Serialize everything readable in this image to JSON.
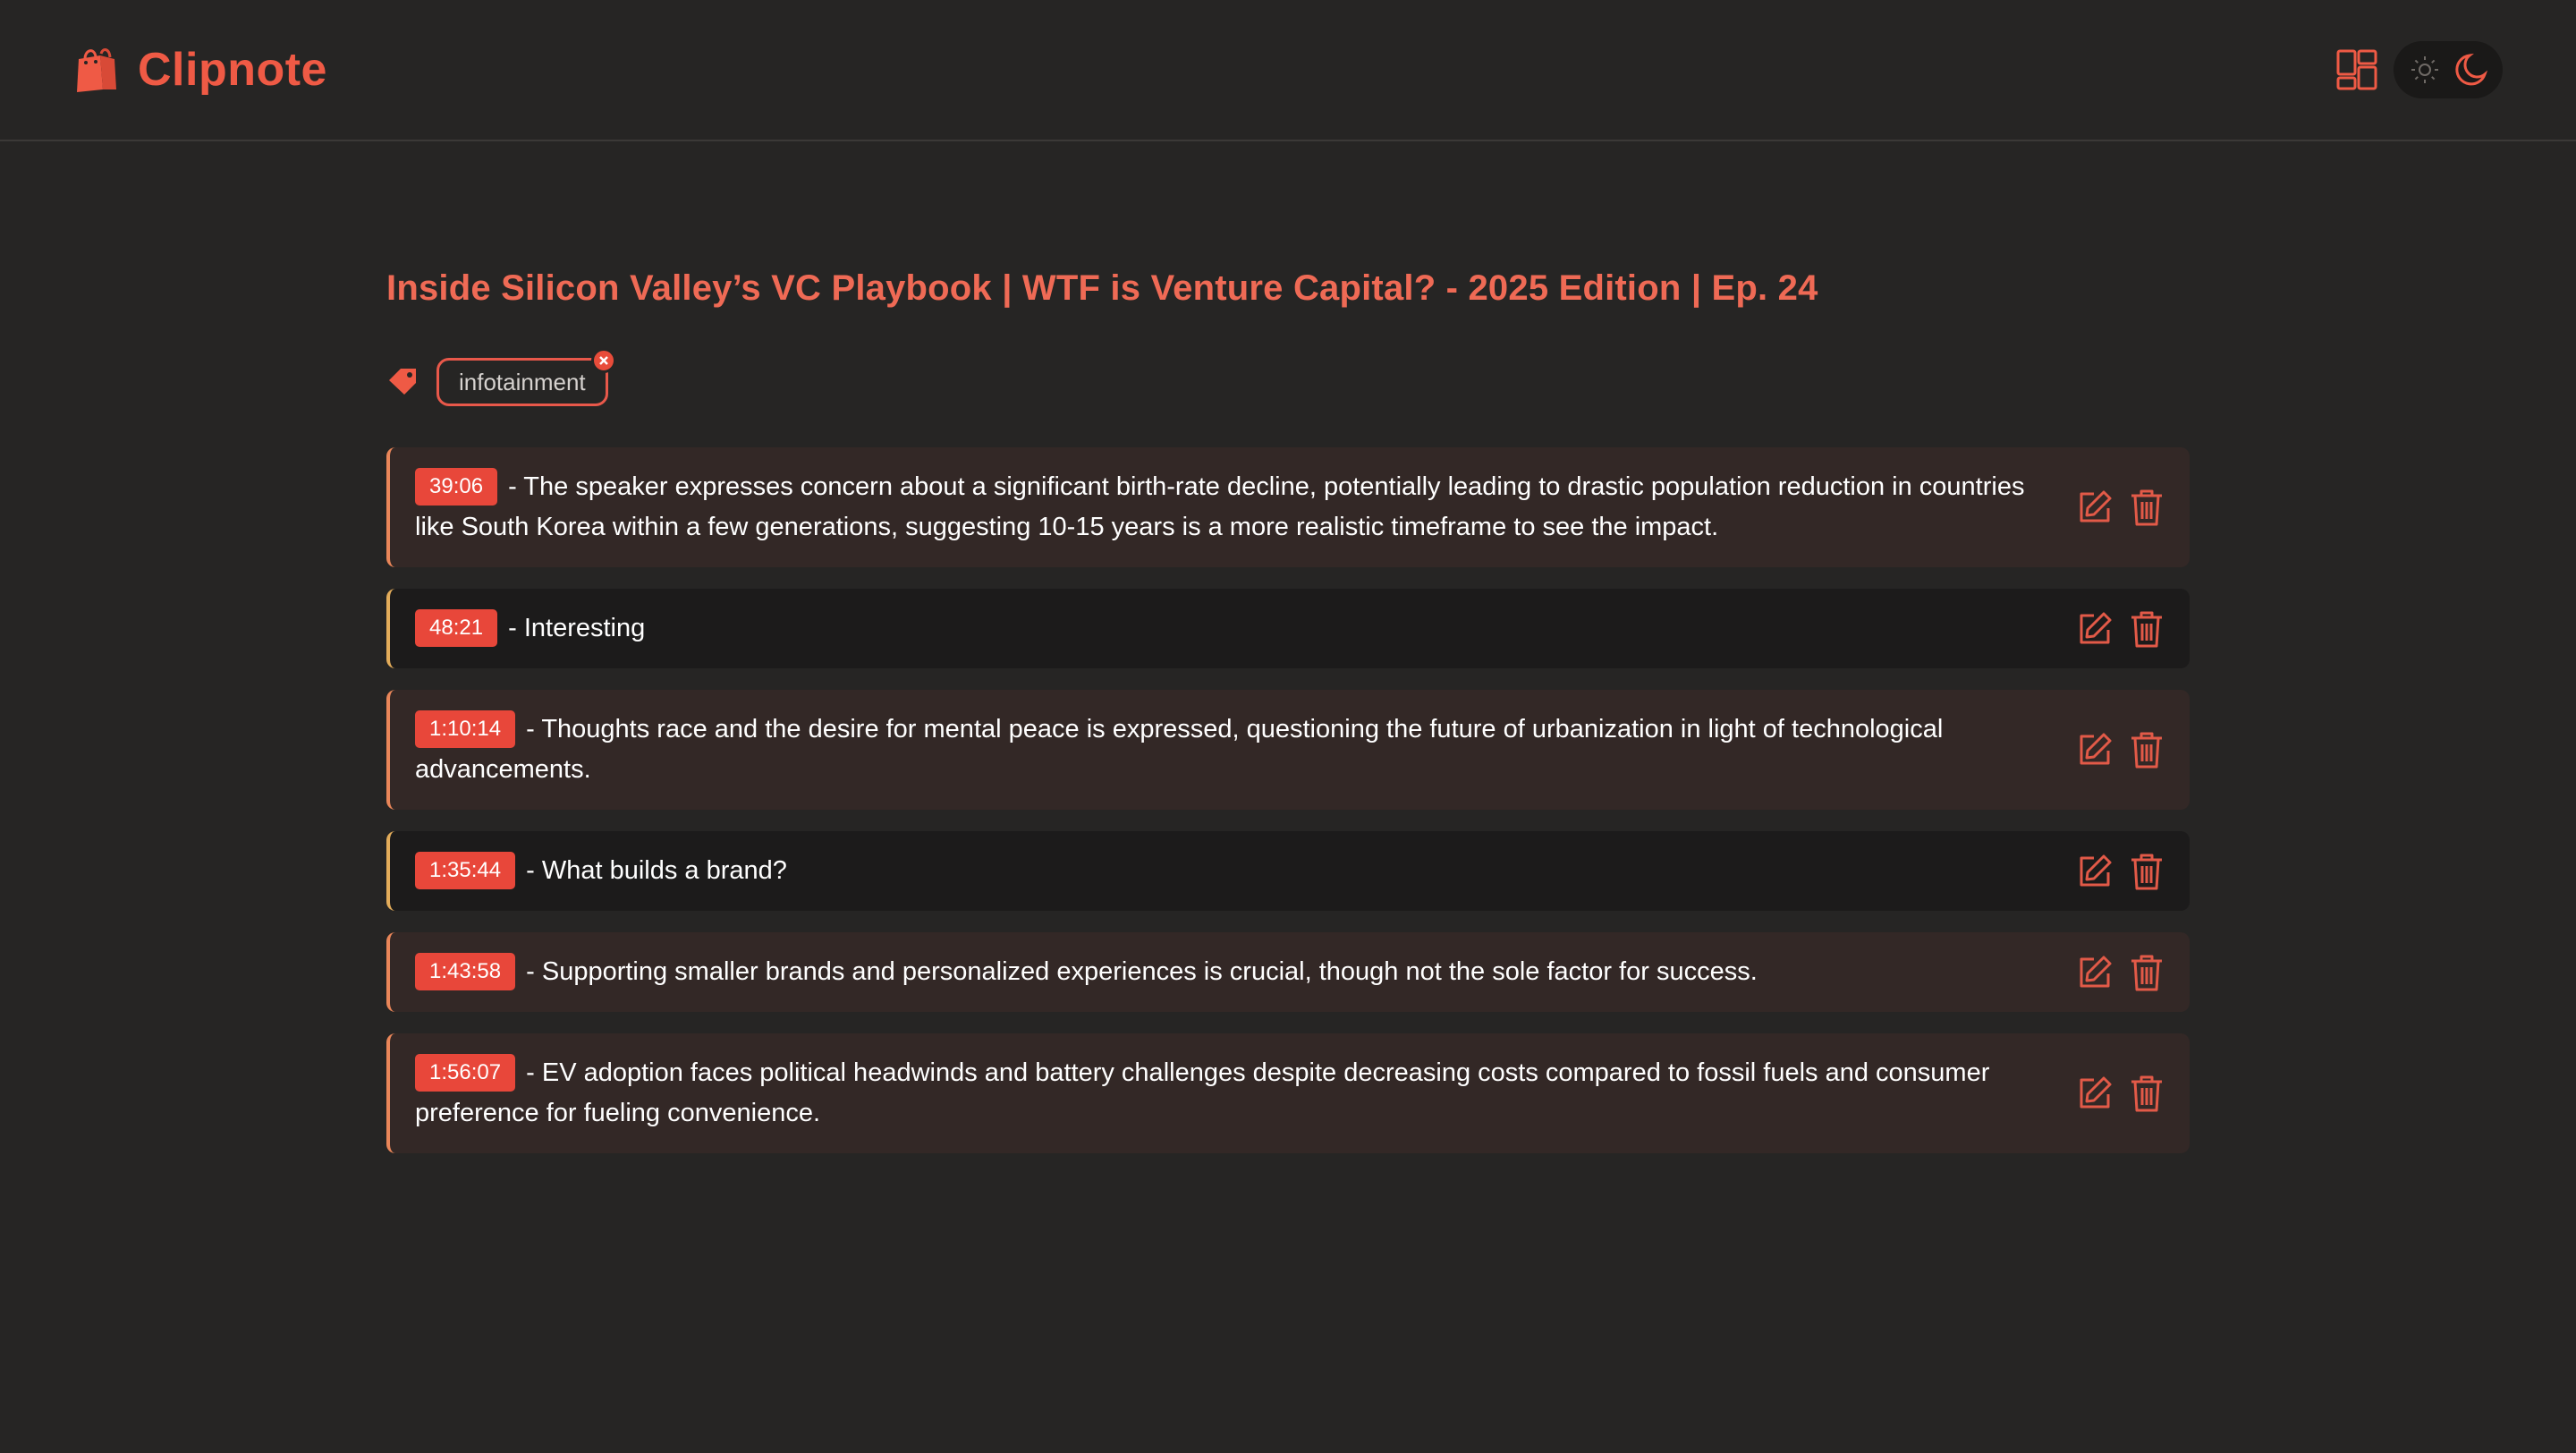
{
  "app": {
    "name": "Clipnote",
    "brand_color": "#ef5a45",
    "logo_icon": "shopping-bag-icon"
  },
  "header": {
    "layout_icon": "layout-grid-icon",
    "theme_toggle": {
      "light_icon": "sun-icon",
      "dark_icon": "moon-icon",
      "active": "dark"
    }
  },
  "video": {
    "title": "Inside Silicon Valley’s VC Playbook | WTF is Venture Capital? - 2025 Edition | Ep. 24"
  },
  "tags": {
    "icon": "tag-icon",
    "items": [
      {
        "label": "infotainment"
      }
    ]
  },
  "notes": [
    {
      "timestamp": "39:06",
      "text": " - The speaker expresses concern about a significant birth-rate decline, potentially leading to drastic population reduction in countries like South Korea within a few generations, suggesting 10-15 years is a more realistic timeframe to see the impact.",
      "style": "warm"
    },
    {
      "timestamp": "48:21",
      "text": " - Interesting",
      "style": "dark"
    },
    {
      "timestamp": "1:10:14",
      "text": " - Thoughts race and the desire for mental peace is expressed, questioning the future of urbanization in light of technological advancements.",
      "style": "warm"
    },
    {
      "timestamp": "1:35:44",
      "text": " - What builds a brand?",
      "style": "dark"
    },
    {
      "timestamp": "1:43:58",
      "text": " - Supporting smaller brands and personalized experiences is crucial, though not the sole factor for success.",
      "style": "warm"
    },
    {
      "timestamp": "1:56:07",
      "text": " - EV adoption faces political headwinds and battery challenges despite decreasing costs compared to fossil fuels and consumer preference for fueling convenience.",
      "style": "warm"
    }
  ],
  "note_actions": {
    "edit_icon": "edit-icon",
    "delete_icon": "trash-icon"
  }
}
